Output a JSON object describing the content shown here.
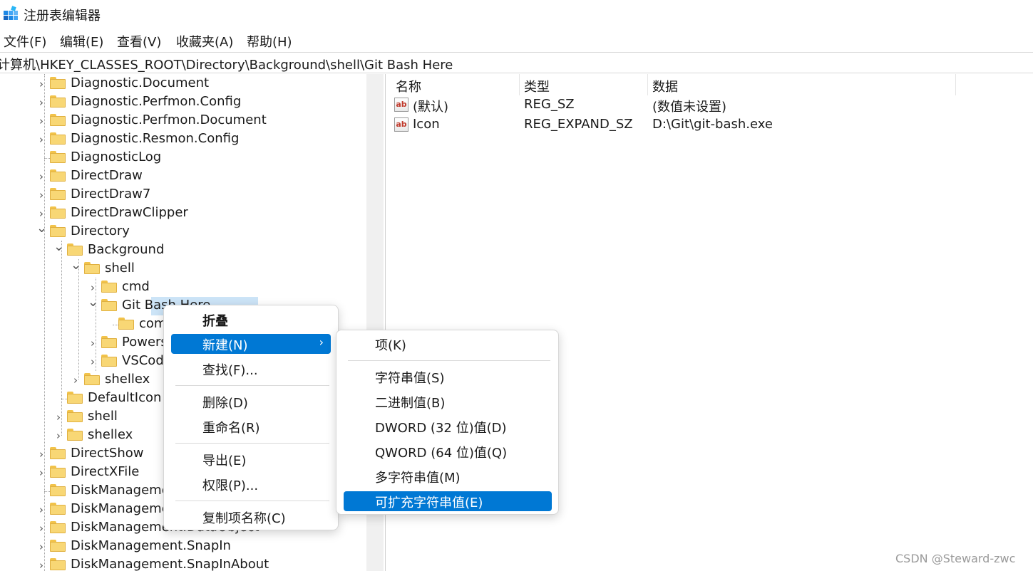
{
  "window": {
    "title": "注册表编辑器",
    "icon": "registry-editor-icon"
  },
  "menubar": [
    "文件(F)",
    "编辑(E)",
    "查看(V)",
    "收藏夹(A)",
    "帮助(H)"
  ],
  "address": "计算机\\HKEY_CLASSES_ROOT\\Directory\\Background\\shell\\Git Bash Here",
  "tree": [
    {
      "label": "Diagnostic.Document",
      "level": 0,
      "expand": "collapsed"
    },
    {
      "label": "Diagnostic.Perfmon.Config",
      "level": 0,
      "expand": "collapsed"
    },
    {
      "label": "Diagnostic.Perfmon.Document",
      "level": 0,
      "expand": "collapsed"
    },
    {
      "label": "Diagnostic.Resmon.Config",
      "level": 0,
      "expand": "collapsed"
    },
    {
      "label": "DiagnosticLog",
      "level": 0,
      "expand": "none"
    },
    {
      "label": "DirectDraw",
      "level": 0,
      "expand": "collapsed"
    },
    {
      "label": "DirectDraw7",
      "level": 0,
      "expand": "collapsed"
    },
    {
      "label": "DirectDrawClipper",
      "level": 0,
      "expand": "collapsed"
    },
    {
      "label": "Directory",
      "level": 0,
      "expand": "expanded"
    },
    {
      "label": "Background",
      "level": 1,
      "expand": "expanded"
    },
    {
      "label": "shell",
      "level": 2,
      "expand": "expanded"
    },
    {
      "label": "cmd",
      "level": 3,
      "expand": "collapsed"
    },
    {
      "label": "Git Bash Here",
      "level": 3,
      "expand": "expanded",
      "selected": true
    },
    {
      "label": "command",
      "level": 4,
      "expand": "none"
    },
    {
      "label": "Powershell",
      "level": 3,
      "expand": "collapsed"
    },
    {
      "label": "VSCode",
      "level": 3,
      "expand": "collapsed"
    },
    {
      "label": "shellex",
      "level": 2,
      "expand": "collapsed"
    },
    {
      "label": "DefaultIcon",
      "level": 1,
      "expand": "none"
    },
    {
      "label": "shell",
      "level": 1,
      "expand": "collapsed"
    },
    {
      "label": "shellex",
      "level": 1,
      "expand": "collapsed"
    },
    {
      "label": "DirectShow",
      "level": 0,
      "expand": "collapsed"
    },
    {
      "label": "DirectXFile",
      "level": 0,
      "expand": "collapsed"
    },
    {
      "label": "DiskManagement.Connection",
      "level": 0,
      "expand": "none"
    },
    {
      "label": "DiskManagement.Control",
      "level": 0,
      "expand": "collapsed"
    },
    {
      "label": "DiskManagement.DataObject",
      "level": 0,
      "expand": "collapsed"
    },
    {
      "label": "DiskManagement.SnapIn",
      "level": 0,
      "expand": "collapsed"
    },
    {
      "label": "DiskManagement.SnapInAbout",
      "level": 0,
      "expand": "collapsed"
    }
  ],
  "list": {
    "headers": [
      "名称",
      "类型",
      "数据"
    ],
    "rows": [
      {
        "name": "(默认)",
        "type": "REG_SZ",
        "data": "(数值未设置)",
        "icon": "string-value-icon"
      },
      {
        "name": "Icon",
        "type": "REG_EXPAND_SZ",
        "data": "D:\\Git\\git-bash.exe",
        "icon": "string-value-icon"
      }
    ]
  },
  "context_menu": {
    "items": [
      "折叠",
      "新建(N)",
      "查找(F)...",
      "删除(D)",
      "重命名(R)",
      "导出(E)",
      "权限(P)...",
      "复制项名称(C)"
    ],
    "active": "新建(N)"
  },
  "submenu": {
    "items": [
      "项(K)",
      "字符串值(S)",
      "二进制值(B)",
      "DWORD (32 位)值(D)",
      "QWORD (64 位)值(Q)",
      "多字符串值(M)",
      "可扩充字符串值(E)"
    ],
    "active": "可扩充字符串值(E)"
  },
  "colors": {
    "accent": "#0078d4",
    "selection": "#cce4f7",
    "folder": "#f8d775"
  },
  "watermark": "CSDN @Steward-zwc"
}
